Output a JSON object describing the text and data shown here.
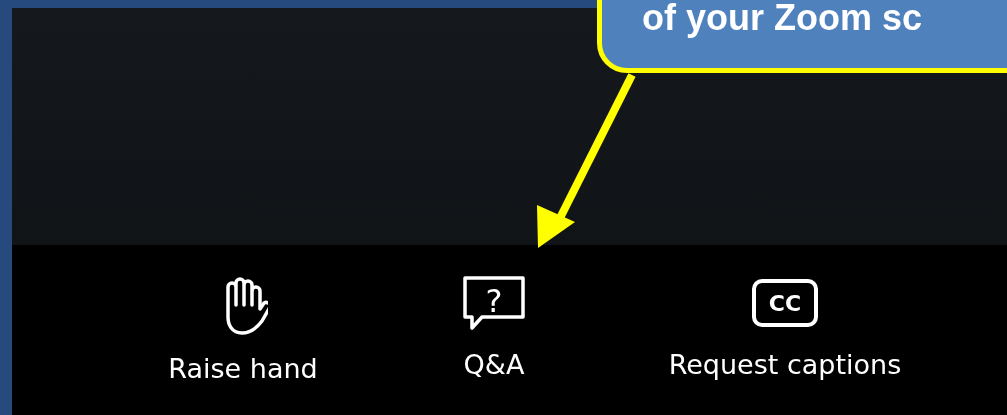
{
  "callout": {
    "text": "of your Zoom sc"
  },
  "toolbar": {
    "items": [
      {
        "kind": "hand",
        "label": "Raise hand"
      },
      {
        "kind": "qa",
        "label": "Q&A",
        "glyph": "?"
      },
      {
        "kind": "cc",
        "label": "Request captions",
        "glyph": "CC"
      }
    ]
  }
}
